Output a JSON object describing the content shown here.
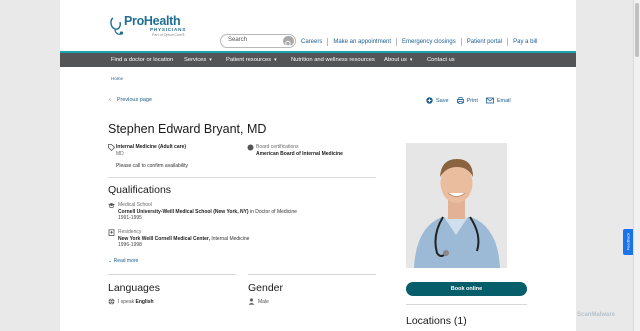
{
  "logo": {
    "main": "ProHealth",
    "sub": "PHYSICIANS",
    "tagline": "Part of OptumCare®"
  },
  "search": {
    "placeholder": "Search"
  },
  "top_links": [
    "Careers",
    "Make an appointment",
    "Emergency closings",
    "Patient portal",
    "Pay a bill"
  ],
  "nav": {
    "find_doctor": "Find a doctor or location",
    "services": "Services",
    "patient_resources": "Patient resources",
    "nutrition": "Nutrition and wellness resources",
    "about": "About us",
    "contact": "Contact us"
  },
  "breadcrumb": "Home",
  "previous_page": "Previous page",
  "actions": {
    "save": "Save",
    "print": "Print",
    "email": "Email"
  },
  "doctor": {
    "name": "Stephen Edward Bryant, MD",
    "specialty": "Internal Medicine (Adult care)",
    "credential": "MD",
    "availability": "Please call to confirm availability",
    "board_label": "Board certifications",
    "board_value": "American Board of Internal Medicine"
  },
  "qualifications": {
    "title": "Qualifications",
    "med_school_label": "Medical School",
    "med_school_name": "Cornell University-Weill Medical School (New York, NY)",
    "med_school_degree": "in Doctor of Medicine",
    "med_school_years": "1991-1995",
    "residency_label": "Residency",
    "residency_name": "New York Weill Cornell Medical Center,",
    "residency_field": "Internal Medicine",
    "residency_years": "1996-1998",
    "read_more": "Read more"
  },
  "languages": {
    "title": "Languages",
    "prefix": "I speak",
    "value": "English"
  },
  "gender": {
    "title": "Gender",
    "value": "Male"
  },
  "book_button": "Book online",
  "locations_title": "Locations (1)",
  "feedback": "Feedback",
  "watermark": "ScanMalware",
  "colors": {
    "brand": "#1f6f93",
    "nav_bg": "#525456",
    "accent_line": "#1aa6b0",
    "button": "#075e6b",
    "link": "#1b5d8f"
  }
}
